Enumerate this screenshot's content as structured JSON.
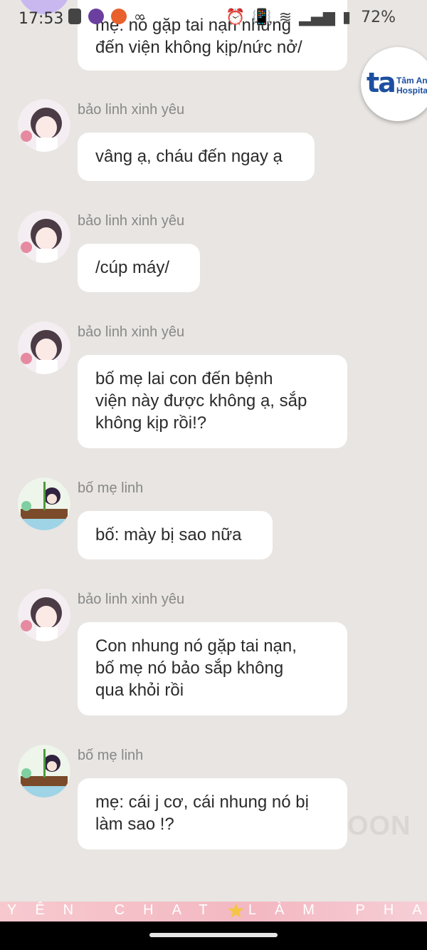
{
  "status_bar": {
    "time": "17:53",
    "battery": "72%"
  },
  "colors": {
    "background": "#e8e5e2",
    "bubble": "#ffffff",
    "sender_text": "#888888",
    "logo_blue": "#1c4fa0"
  },
  "logo": {
    "mark": "ta",
    "line1": "Tâm Anh",
    "line2": "Hospital"
  },
  "top_partial_message": {
    "text": "mẹ: nó gặp tai nạn nhưng\nđến viện không kịp/nức nở/"
  },
  "messages": [
    {
      "sender": "bảo linh xinh yêu",
      "text": "vâng ạ, cháu đến ngay ạ"
    },
    {
      "sender": "bảo linh xinh yêu",
      "text": "/cúp máy/"
    },
    {
      "sender": "bảo linh xinh yêu",
      "text": "bố mẹ lai con đến bệnh\nviện này được không ạ, sắp\nkhông kịp rồi!?"
    },
    {
      "sender": "bố mẹ linh",
      "text": "bố: mày bị sao nữa"
    },
    {
      "sender": "bảo linh xinh yêu",
      "text": "Con nhung nó gặp tai nạn,\nbố mẹ nó bảo sắp không\nqua khỏi rồi"
    },
    {
      "sender": "bố mẹ linh",
      "text": "mẹ: cái j cơ, cái nhung nó bị\nlàm sao !?"
    }
  ],
  "watermark": "OON",
  "bottom_banner": {
    "text": "YÊN CHAT LÀM PHA"
  }
}
